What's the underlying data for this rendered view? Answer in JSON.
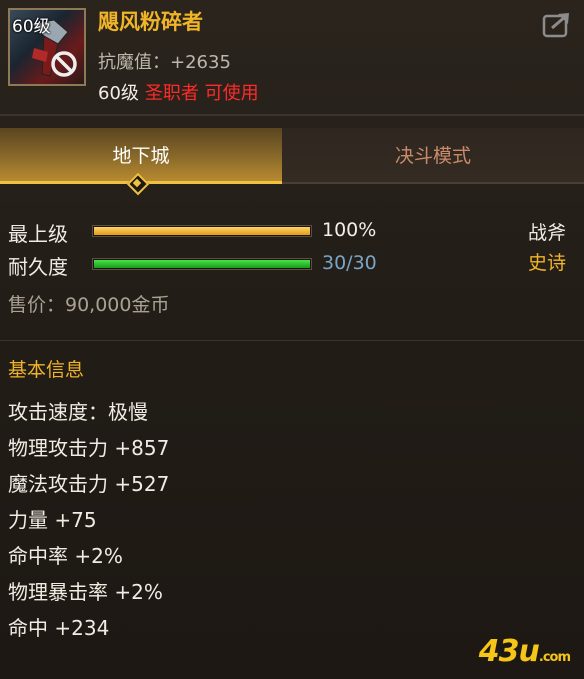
{
  "item": {
    "level_badge": "60级",
    "name": "飓风粉碎者",
    "anti_magic": "抗魔值：+2635",
    "req_level": "60级",
    "req_class": "圣职者 可使用"
  },
  "tabs": [
    {
      "label": "地下城",
      "active": true
    },
    {
      "label": "决斗模式",
      "active": false
    }
  ],
  "stats": {
    "grade": {
      "label": "最上级",
      "value": "100%",
      "fraction": 1.0
    },
    "durability": {
      "label": "耐久度",
      "value": "30/30",
      "fraction": 1.0
    },
    "weapon_type": "战斧",
    "rarity": "史诗",
    "price": "售价：90,000金币"
  },
  "basic_info": {
    "title": "基本信息",
    "attributes": [
      "攻击速度：极慢",
      "物理攻击力 +857",
      "魔法攻击力 +527",
      "力量 +75",
      "命中率 +2%",
      "物理暴击率 +2%",
      "命中 +234"
    ]
  },
  "watermark": {
    "main": "43u",
    "suffix": ".com"
  },
  "colors": {
    "gold": "#f0b429",
    "red": "#ff2a2a",
    "green_bar": "#2fc22f",
    "gold_bar": "#f0a825"
  },
  "icons": {
    "share": "share-arrow-icon",
    "forbidden": "no-use-icon",
    "weapon": "battle-axe-icon"
  }
}
